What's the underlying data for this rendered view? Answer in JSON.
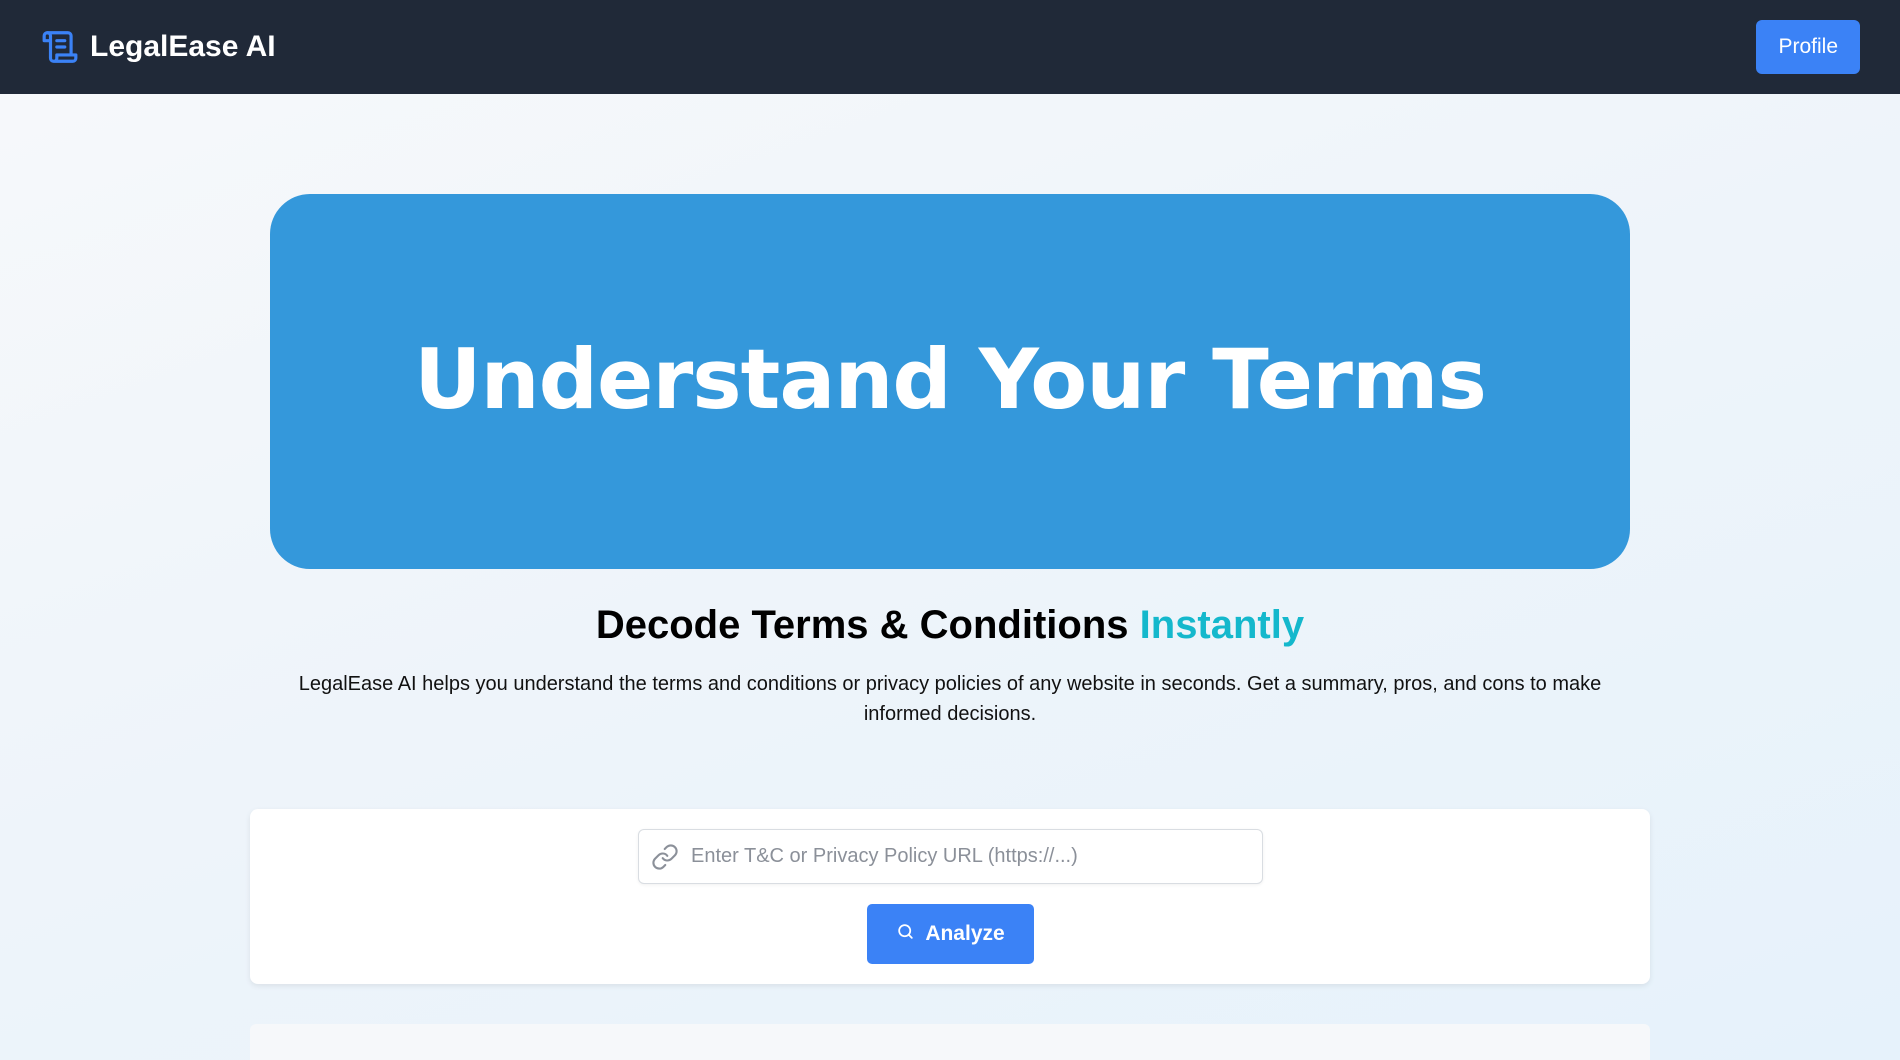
{
  "nav": {
    "brand_icon": "scroll-icon",
    "brand_name": "LegalEase AI",
    "profile_label": "Profile"
  },
  "hero": {
    "banner_text": "Understand Your Terms"
  },
  "headline": {
    "main": "Decode Terms & Conditions",
    "accent": "Instantly"
  },
  "description": "LegalEase AI helps you understand the terms and conditions or privacy policies of any website in seconds. Get a summary, pros, and cons to make informed decisions.",
  "analyzer": {
    "link_icon": "link-icon",
    "url_value": "",
    "url_placeholder": "Enter T&C or Privacy Policy URL (https://...)",
    "search_icon": "search-icon",
    "analyze_label": "Analyze"
  },
  "colors": {
    "nav_bg": "#202938",
    "accent_blue": "#3b82f6",
    "hero_blue": "#3498db",
    "accent_cyan": "#14b8cc"
  }
}
